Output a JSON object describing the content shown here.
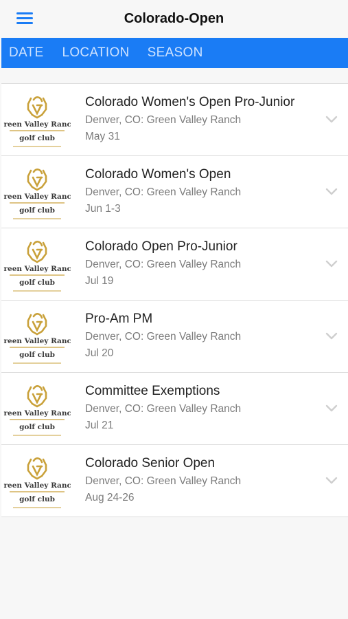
{
  "header": {
    "title": "Colorado-Open",
    "menu_icon": "hamburger-menu-icon",
    "accent_color": "#1a7cf5"
  },
  "tabs": [
    {
      "label": "DATE"
    },
    {
      "label": "LOCATION"
    },
    {
      "label": "SEASON"
    }
  ],
  "logo": {
    "line1": "Green Valley Ranch",
    "line2": "golf club",
    "gold_color": "#c9a13a"
  },
  "events": [
    {
      "title": "Colorado Women's Open Pro-Junior",
      "location": "Denver, CO: Green Valley Ranch",
      "date": "May 31"
    },
    {
      "title": "Colorado Women's Open",
      "location": "Denver, CO: Green Valley Ranch",
      "date": "Jun 1-3"
    },
    {
      "title": "Colorado Open Pro-Junior",
      "location": "Denver, CO: Green Valley Ranch",
      "date": "Jul 19"
    },
    {
      "title": "Pro-Am PM",
      "location": "Denver, CO: Green Valley Ranch",
      "date": "Jul 20"
    },
    {
      "title": "Committee Exemptions",
      "location": "Denver, CO: Green Valley Ranch",
      "date": "Jul 21"
    },
    {
      "title": "Colorado Senior Open",
      "location": "Denver, CO: Green Valley Ranch",
      "date": "Aug 24-26"
    }
  ]
}
